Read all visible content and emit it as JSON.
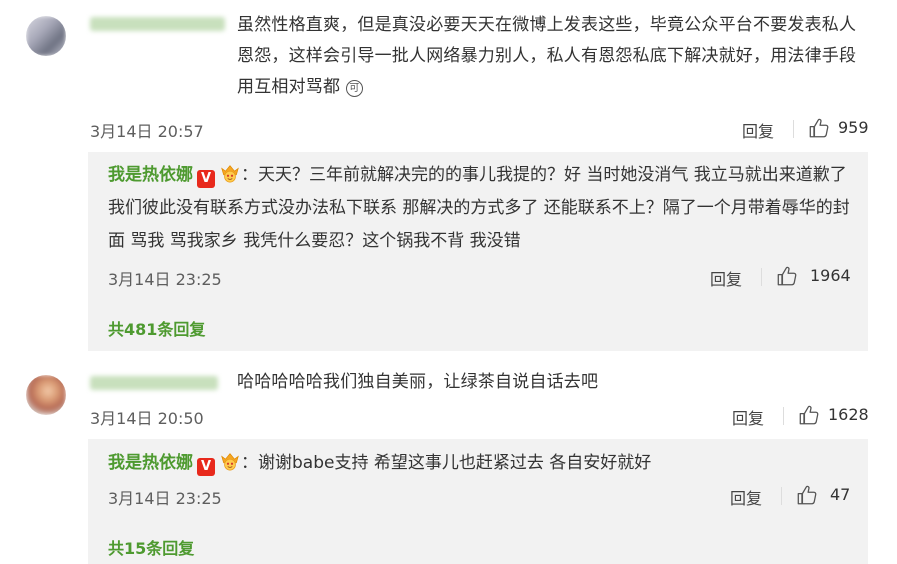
{
  "comments": [
    {
      "text": "虽然性格直爽，但是真没必要天天在微博上发表这些，毕竟公众平台不要发表私人恩怨，这样会引导一批人网络暴力别人，私人有恩怨私底下解决就好，用法律手段用互相对骂都",
      "ke_icon": "可",
      "time": "3月14日 20:57",
      "reply_label": "回复",
      "likes": "959",
      "reply": {
        "name": "我是热依娜",
        "colon": "：",
        "text": "天天？三年前就解决完的的事儿我提的？好 当时她没消气 我立马就出来道歉了 我们彼此没有联系方式没办法私下联系 那解决的方式多了 还能联系不上？隔了一个月带着辱华的封面 骂我 骂我家乡 我凭什么要忍？这个锅我不背 我没错",
        "time": "3月14日 23:25",
        "reply_label": "回复",
        "likes": "1964",
        "more": "共481条回复"
      }
    },
    {
      "text": "哈哈哈哈哈我们独自美丽，让绿茶自说自话去吧",
      "time": "3月14日 20:50",
      "reply_label": "回复",
      "likes": "1628",
      "reply": {
        "name": "我是热依娜",
        "colon": "：",
        "text": "谢谢babe支持 希望这事儿也赶紧过去 各自安好就好",
        "time": "3月14日 23:25",
        "reply_label": "回复",
        "likes": "47",
        "more": "共15条回复"
      }
    }
  ],
  "badges": {
    "verified": "V"
  },
  "colors": {
    "name_green": "#4e9a30",
    "reply_bg": "#f2f2f2",
    "verified_red": "#e8291c"
  }
}
